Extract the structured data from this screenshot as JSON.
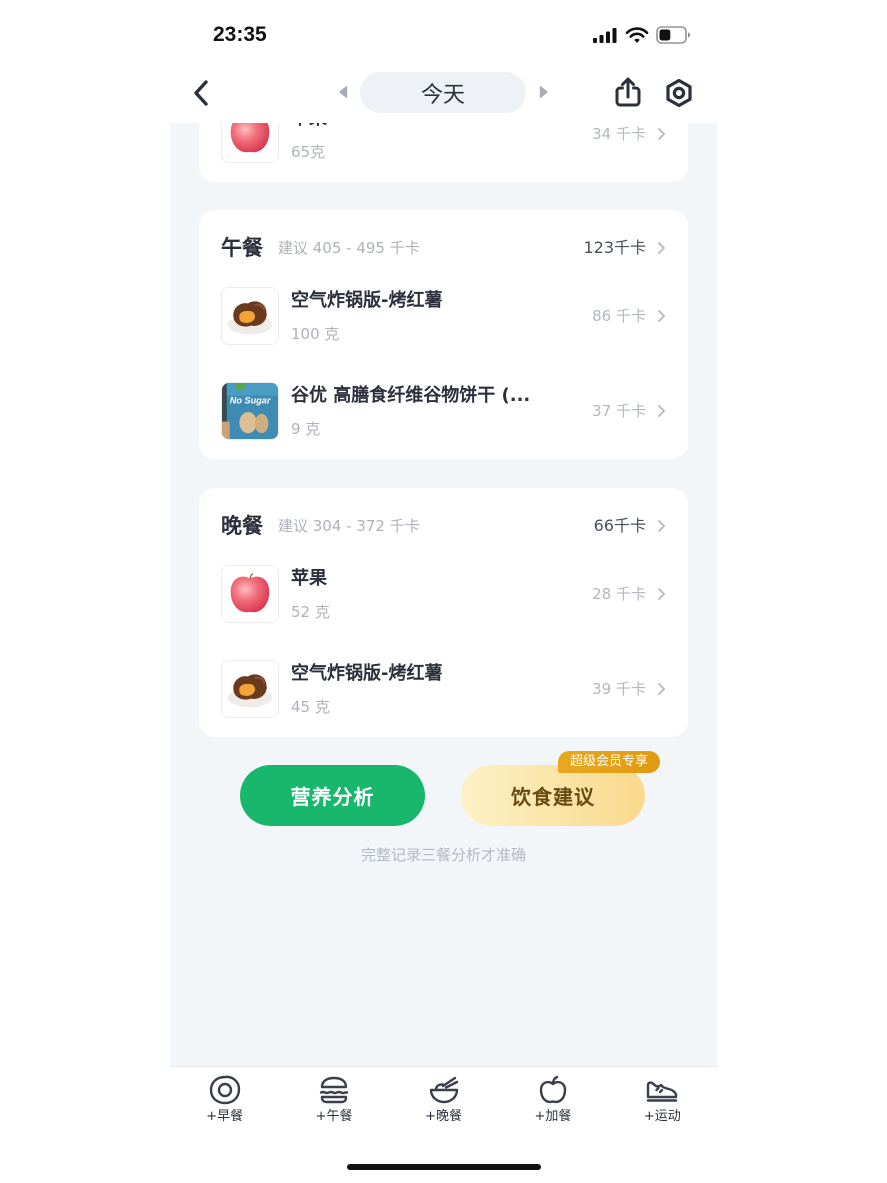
{
  "status_bar": {
    "time": "23:35",
    "battery_level": 0.45,
    "icons": [
      "signal-icon",
      "wifi-icon",
      "battery-icon"
    ]
  },
  "nav": {
    "back_icon": "chevron-left-icon",
    "prev_icon": "triangle-left-icon",
    "date_label": "今天",
    "next_icon": "triangle-right-icon",
    "share_icon": "share-icon",
    "settings_icon": "settings-icon"
  },
  "meals": [
    {
      "items": [
        {
          "name": "苹果",
          "amount": "65克",
          "kcal": "34 千卡",
          "image": "apple"
        }
      ]
    },
    {
      "title": "午餐",
      "suggestion": "建议 405 - 495 千卡",
      "total": "123千卡",
      "items": [
        {
          "name": "空气炸锅版-烤红薯",
          "amount": "100 克",
          "kcal": "86 千卡",
          "image": "roasted-sweet-potato"
        },
        {
          "name": "谷优 高膳食纤维谷物饼干 (...",
          "amount": "9 克",
          "kcal": "37 千卡",
          "image": "cookie-package",
          "image_text": "No Sugar"
        }
      ]
    },
    {
      "title": "晚餐",
      "suggestion": "建议 304 - 372 千卡",
      "total": "66千卡",
      "items": [
        {
          "name": "苹果",
          "amount": "52 克",
          "kcal": "28 千卡",
          "image": "apple"
        },
        {
          "name": "空气炸锅版-烤红薯",
          "amount": "45 克",
          "kcal": "39 千卡",
          "image": "roasted-sweet-potato"
        }
      ]
    }
  ],
  "actions": {
    "analysis_label": "营养分析",
    "advice_label": "饮食建议",
    "advice_badge": "超级会员专享",
    "hint": "完整记录三餐分析才准确"
  },
  "tabbar": {
    "items": [
      {
        "label": "+早餐",
        "icon": "fried-egg-icon"
      },
      {
        "label": "+午餐",
        "icon": "burger-icon"
      },
      {
        "label": "+晚餐",
        "icon": "bowl-icon"
      },
      {
        "label": "+加餐",
        "icon": "apple-icon"
      },
      {
        "label": "+运动",
        "icon": "sneaker-icon"
      }
    ]
  },
  "colors": {
    "page_background": "#f3f6f9",
    "card_background": "#ffffff",
    "primary_green": "#18b76c",
    "advice_gradient_start": "#fdf1c6",
    "advice_gradient_end": "#f9d98c",
    "badge_gold": "#e6a21a",
    "text_primary": "#2b303b",
    "text_secondary": "#aeb2b9"
  }
}
